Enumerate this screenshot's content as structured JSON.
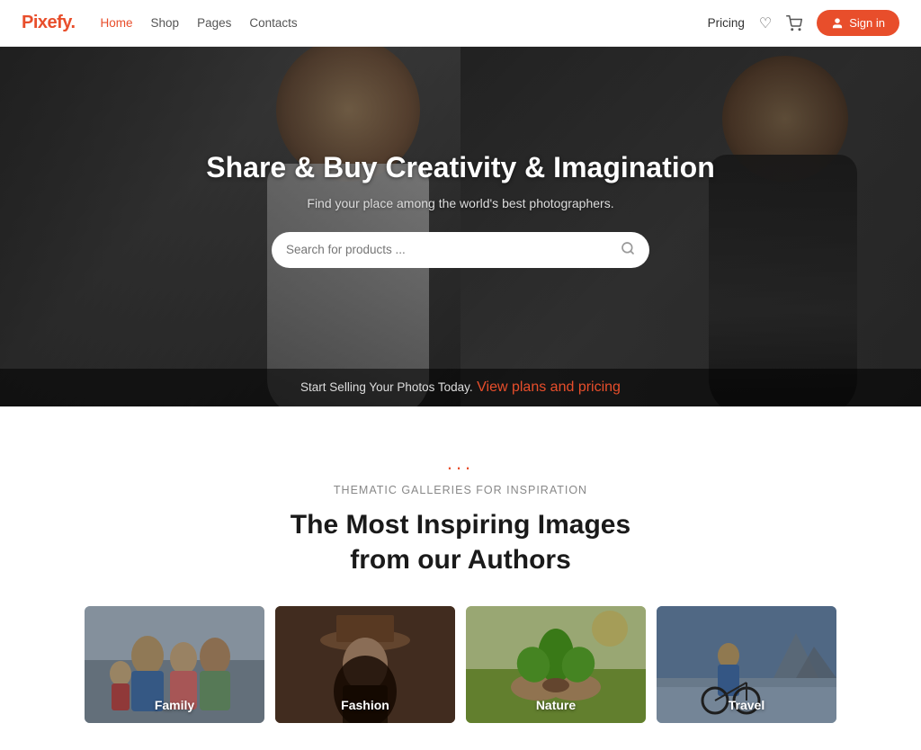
{
  "header": {
    "logo": "Pixefy",
    "logo_dot": ".",
    "nav": [
      {
        "label": "Home",
        "active": true
      },
      {
        "label": "Shop",
        "active": false
      },
      {
        "label": "Pages",
        "active": false
      },
      {
        "label": "Contacts",
        "active": false
      }
    ],
    "pricing_label": "Pricing",
    "signin_label": "Sign in"
  },
  "hero": {
    "title": "Share & Buy Creativity & Imagination",
    "subtitle": "Find your place among the world's best photographers.",
    "search_placeholder": "Search for products ...",
    "bottom_text": "Start Selling Your Photos Today.",
    "bottom_link": "View plans and pricing"
  },
  "section": {
    "dots": "...",
    "subtitle": "Thematic Galleries for Inspiration",
    "title_line1": "The Most Inspiring Images",
    "title_line2": "from our Authors",
    "gallery": [
      {
        "label": "Family",
        "key": "family"
      },
      {
        "label": "Fashion",
        "key": "fashion"
      },
      {
        "label": "Nature",
        "key": "nature"
      },
      {
        "label": "Travel",
        "key": "travel"
      }
    ]
  },
  "icons": {
    "heart": "♡",
    "cart": "🛒",
    "user": "👤",
    "search": "🔍"
  }
}
